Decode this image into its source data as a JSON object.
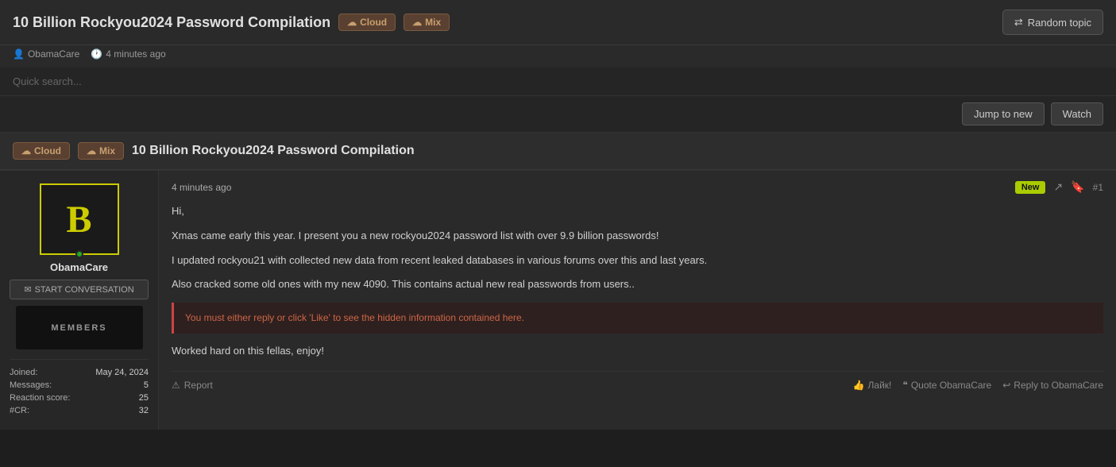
{
  "header": {
    "title": "10 Billion Rockyou2024 Password Compilation",
    "tag_cloud": "Cloud",
    "tag_mix": "Mix",
    "random_topic_btn": "Random topic",
    "author": "ObamaCare",
    "timestamp": "4 minutes ago"
  },
  "search": {
    "placeholder": "Quick search..."
  },
  "actions": {
    "jump_to_new": "Jump to new",
    "watch": "Watch"
  },
  "post_title_row": {
    "tag_cloud": "Cloud",
    "tag_mix": "Mix",
    "title": "10 Billion Rockyou2024 Password Compilation"
  },
  "post": {
    "timestamp": "4 minutes ago",
    "new_badge": "New",
    "post_number": "#1",
    "body_line1": "Hi,",
    "body_line2": "Xmas came early this year. I present you a new rockyou2024 password list with over 9.9 billion passwords!",
    "body_line3": "I updated rockyou21 with collected new data from recent leaked databases in various forums over this and last years.",
    "body_line4": "Also cracked some old ones with my new 4090. This contains actual new real passwords from users..",
    "hidden_info": "You must either reply or click 'Like' to see the hidden information contained here.",
    "body_line5": "Worked hard on this fellas, enjoy!",
    "report": "Report",
    "like_btn": "Лайк!",
    "quote_btn": "Quote ObamaCare",
    "reply_btn": "Reply to ObamaCare"
  },
  "user": {
    "username": "ObamaCare",
    "start_conversation": "START CONVERSATION",
    "banner_text": "MEMBERS",
    "joined_label": "Joined:",
    "joined_val": "May 24, 2024",
    "messages_label": "Messages:",
    "messages_val": "5",
    "reaction_label": "Reaction score:",
    "reaction_val": "25",
    "cr_label": "#CR:",
    "cr_val": "32",
    "avatar_letter": "B"
  }
}
